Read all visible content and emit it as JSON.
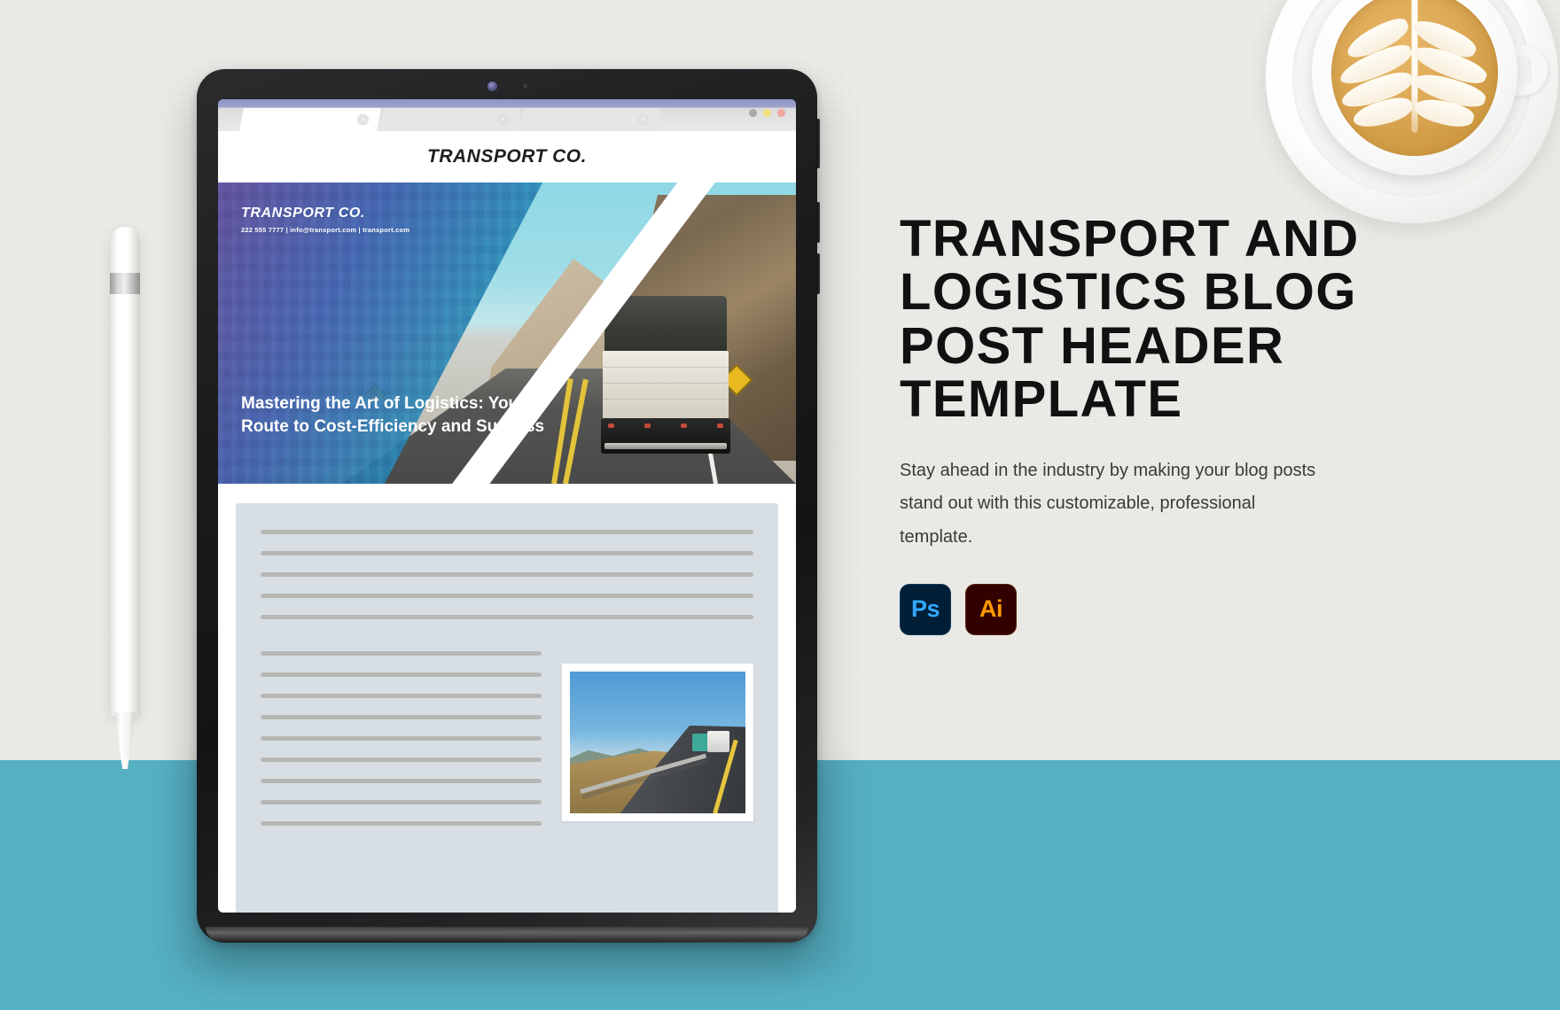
{
  "scene": {
    "background_color": "#edece8",
    "desk_color": "#56b0c4"
  },
  "coffee": {
    "name": "latte-cup-with-rosetta-art"
  },
  "stylus": {
    "name": "white-stylus-pen"
  },
  "tablet": {
    "browser": {
      "tabs": [
        {
          "label": "",
          "active": true,
          "close_label": "×"
        },
        {
          "label": "",
          "active": false,
          "close_label": "×"
        },
        {
          "label": "",
          "active": false,
          "close_label": "×"
        }
      ],
      "window_dots": [
        "#a9a9a9",
        "#f2e07a",
        "#f0a7a0"
      ]
    },
    "site": {
      "header_brand": "TRANSPORT CO.",
      "hero": {
        "brand": "TRANSPORT CO.",
        "contact": "222 555 7777 | info@transport.com | transport.com",
        "title": "Mastering the Art of Logistics: Your Route to Cost-Efficiency and Success",
        "photo_alt": "rear-view-of-cargo-truck-on-mountain-road"
      },
      "article": {
        "top_lines": 5,
        "bottom_lines": 9,
        "inset_photo_alt": "truck-on-winding-hillside-highway"
      },
      "footer_color": "#424e84"
    }
  },
  "right_panel": {
    "title": "TRANSPORT AND LOGISTICS BLOG POST HEADER TEMPLATE",
    "description": "Stay ahead in the industry by making your blog posts stand out with this customizable, professional template.",
    "badges": [
      {
        "label": "Ps",
        "name": "photoshop-badge",
        "bg": "#001e36",
        "fg": "#31a8ff"
      },
      {
        "label": "Ai",
        "name": "illustrator-badge",
        "bg": "#330000",
        "fg": "#ff9a00"
      }
    ]
  }
}
